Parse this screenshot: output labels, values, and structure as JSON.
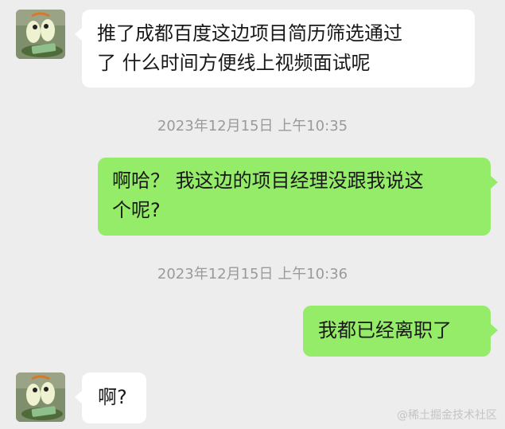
{
  "messages": [
    {
      "side": "in",
      "lines": [
        "推了成都百度这边项目简历筛选通过",
        "了 什么时间方便线上视频面试呢"
      ]
    },
    {
      "timestamp": "2023年12月15日 上午10:35"
    },
    {
      "side": "out",
      "lines": [
        "啊哈？ 我这边的项目经理没跟我说这",
        "个呢?"
      ]
    },
    {
      "timestamp": "2023年12月15日 上午10:36"
    },
    {
      "side": "out",
      "lines": [
        "我都已经离职了"
      ]
    },
    {
      "side": "in",
      "lines": [
        "啊?"
      ]
    }
  ],
  "watermark": "@稀土掘金技术社区",
  "colors": {
    "background": "#ededed",
    "incoming_bubble": "#ffffff",
    "outgoing_bubble": "#95ec69",
    "timestamp_text": "#9a9a9a"
  }
}
